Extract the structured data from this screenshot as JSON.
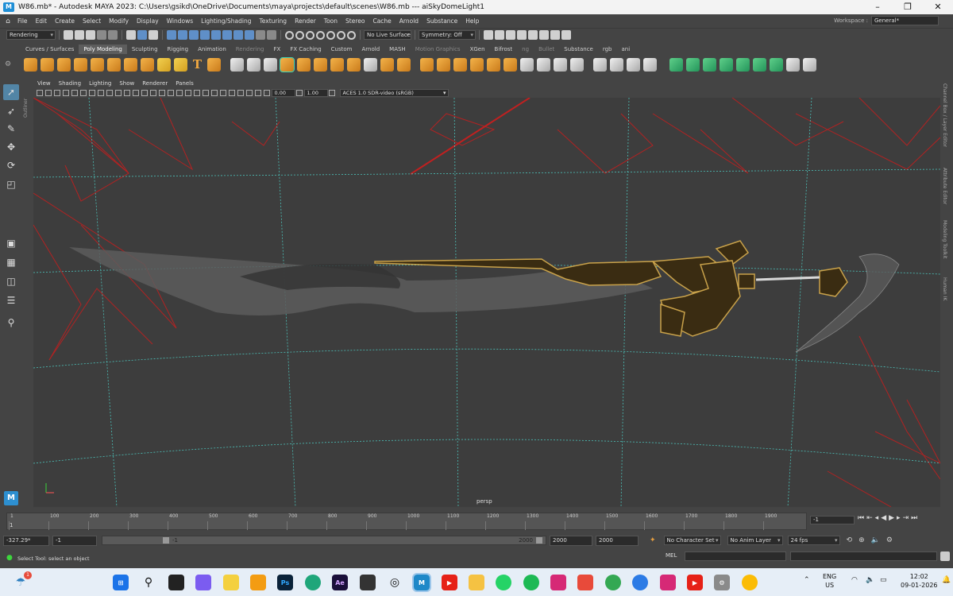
{
  "window": {
    "title": "W86.mb* - Autodesk MAYA 2023: C:\\Users\\gsikd\\OneDrive\\Documents\\maya\\projects\\default\\scenes\\W86.mb  ---   aiSkyDomeLight1",
    "controls": [
      "–",
      "❐",
      "✕"
    ]
  },
  "menubar": {
    "items": [
      "File",
      "Edit",
      "Create",
      "Select",
      "Modify",
      "Display",
      "Windows",
      "Lighting/Shading",
      "Texturing",
      "Render",
      "Toon",
      "Stereo",
      "Cache",
      "Arnold",
      "Substance",
      "Help"
    ],
    "workspace_label": "Workspace :",
    "workspace_value": "General*"
  },
  "statusline": {
    "menuset": "Rendering",
    "live_surface": "No Live Surface",
    "symmetry": "Symmetry: Off"
  },
  "shelf": {
    "tabs": [
      "Curves / Surfaces",
      "Poly Modeling",
      "Sculpting",
      "Rigging",
      "Animation",
      "Rendering",
      "FX",
      "FX Caching",
      "Custom",
      "Arnold",
      "MASH",
      "Motion Graphics",
      "XGen",
      "Bifrost",
      "ng",
      "Bullet",
      "Substance",
      "rgb",
      "ani"
    ],
    "active_tab": "Poly Modeling"
  },
  "viewport": {
    "panel_menu": [
      "View",
      "Shading",
      "Lighting",
      "Show",
      "Renderer",
      "Panels"
    ],
    "exposure": "0.00",
    "gamma": "1.00",
    "color_space": "ACES 1.0 SDR-video (sRGB)",
    "camera": "persp",
    "side_label": "Outliner"
  },
  "right_tabs": [
    "Channel Box / Layer Editor",
    "Attribute Editor",
    "Modeling Toolkit",
    "Human IK"
  ],
  "timeslider": {
    "ticks": [
      "1",
      "100",
      "200",
      "300",
      "400",
      "500",
      "600",
      "700",
      "800",
      "900",
      "1000",
      "1100",
      "1200",
      "1300",
      "1400",
      "1500",
      "1600",
      "1700",
      "1800",
      "1900"
    ],
    "current_frame": "-1",
    "start_marker": "1"
  },
  "rangebar": {
    "scene_start": "-327.29*",
    "playback_start": "-1",
    "range_start_label": "-1",
    "range_end_label": "2000",
    "playback_end": "2000",
    "scene_end": "2000",
    "character_set": "No Character Set",
    "anim_layer": "No Anim Layer",
    "fps": "24 fps"
  },
  "cmdline": {
    "help": "Select Tool: select an object",
    "mel_label": "MEL"
  },
  "taskbar": {
    "lang_line1": "ENG",
    "lang_line2": "US",
    "time": "12:02",
    "date": "09-01-2026",
    "badge": "1"
  }
}
